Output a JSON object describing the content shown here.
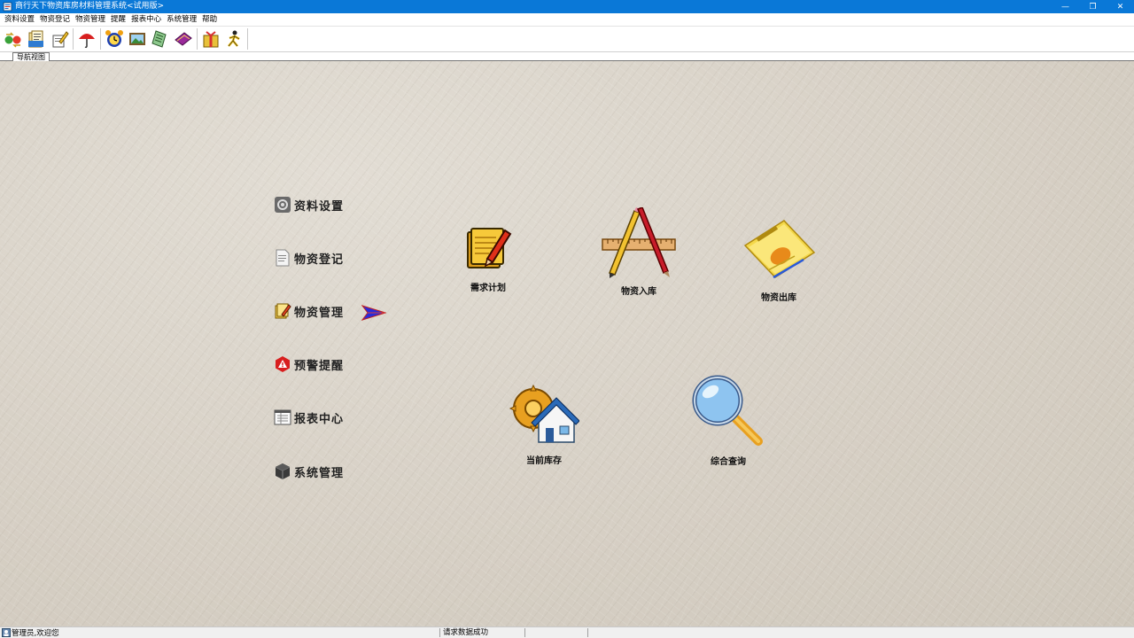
{
  "window": {
    "title": "商行天下物资库房材料管理系统<试用版>",
    "controls": {
      "minimize": "—",
      "maximize": "❐",
      "close": "✕"
    }
  },
  "menu": [
    "资料设置",
    "物资登记",
    "物资管理",
    "提醒",
    "报表中心",
    "系统管理",
    "帮助"
  ],
  "toolbar": {
    "icons": [
      "exchange-icon",
      "folder-docs-icon",
      "edit-note-icon",
      "umbrella-icon",
      "alarm-clock-icon",
      "picture-icon",
      "notebook-icon",
      "book-icon",
      "gift-icon",
      "runner-icon"
    ]
  },
  "tabs": [
    "导航视图"
  ],
  "nav": {
    "items": [
      {
        "label": "资料设置",
        "icon": "settings-icon"
      },
      {
        "label": "物资登记",
        "icon": "document-icon"
      },
      {
        "label": "物资管理",
        "icon": "notes-pencil-icon"
      },
      {
        "label": "预警提醒",
        "icon": "warning-icon"
      },
      {
        "label": "报表中心",
        "icon": "report-icon"
      },
      {
        "label": "系统管理",
        "icon": "cube-icon"
      }
    ],
    "selected": "物资管理"
  },
  "functions": [
    {
      "label": "需求计划",
      "icon": "plan-notes-icon"
    },
    {
      "label": "物资入库",
      "icon": "pencil-ruler-icon"
    },
    {
      "label": "物资出库",
      "icon": "news-paper-icon"
    },
    {
      "label": "当前库存",
      "icon": "house-gear-icon"
    },
    {
      "label": "综合查询",
      "icon": "magnifier-icon"
    }
  ],
  "status": {
    "user": "管理员,欢迎您",
    "message": "请求数据成功"
  },
  "colors": {
    "titlebar": "#0a78d7",
    "background_texture": "#d8d2c8",
    "accent_arrow": "#2a2ad8"
  }
}
